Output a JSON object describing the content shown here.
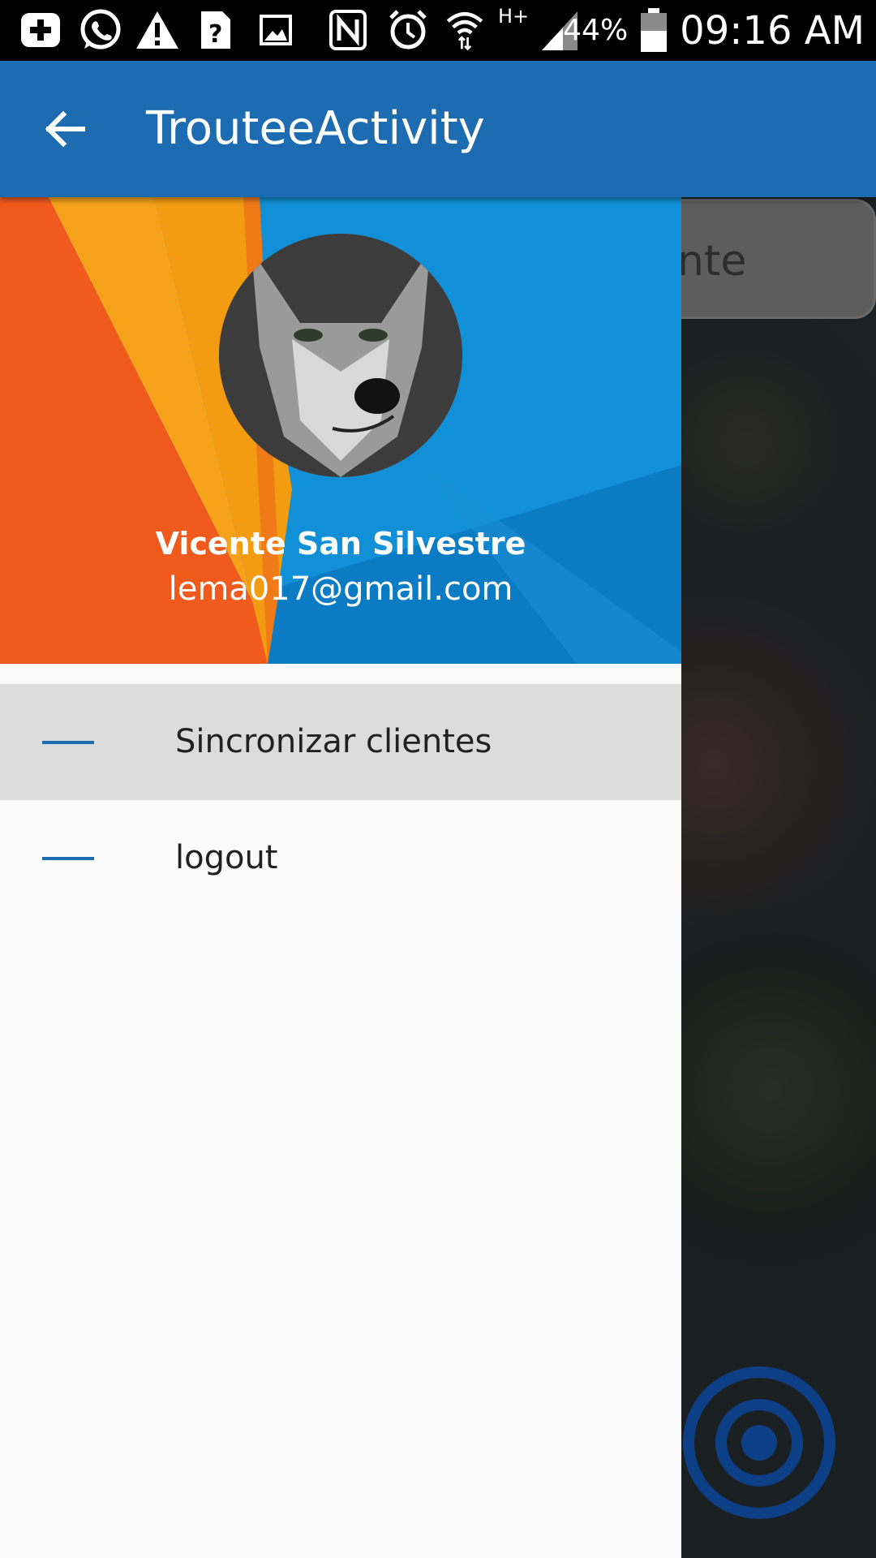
{
  "status_bar": {
    "icons": [
      "add-icon",
      "whatsapp-icon",
      "warning-icon",
      "unknown-file-icon",
      "image-icon",
      "nfc-icon",
      "alarm-icon",
      "wifi-icon",
      "network-hplus-icon",
      "signal-icon",
      "battery-icon"
    ],
    "network_label": "H+",
    "battery": "44%",
    "time": "09:16 AM"
  },
  "app_bar": {
    "title": "TrouteeActivity",
    "back_icon": "arrow-left-icon",
    "color": "#1d6bb0"
  },
  "drawer": {
    "user": {
      "name": "Vicente San Silvestre",
      "email": "lema017@gmail.com",
      "avatar": "wolf-photo"
    },
    "items": [
      {
        "label": "Sincronizar clientes",
        "icon": "dash-icon",
        "active": true
      },
      {
        "label": "logout",
        "icon": "dash-icon",
        "active": false
      }
    ]
  },
  "background": {
    "search_pill_text": "nte",
    "locate_icon": "my-location-icon"
  }
}
